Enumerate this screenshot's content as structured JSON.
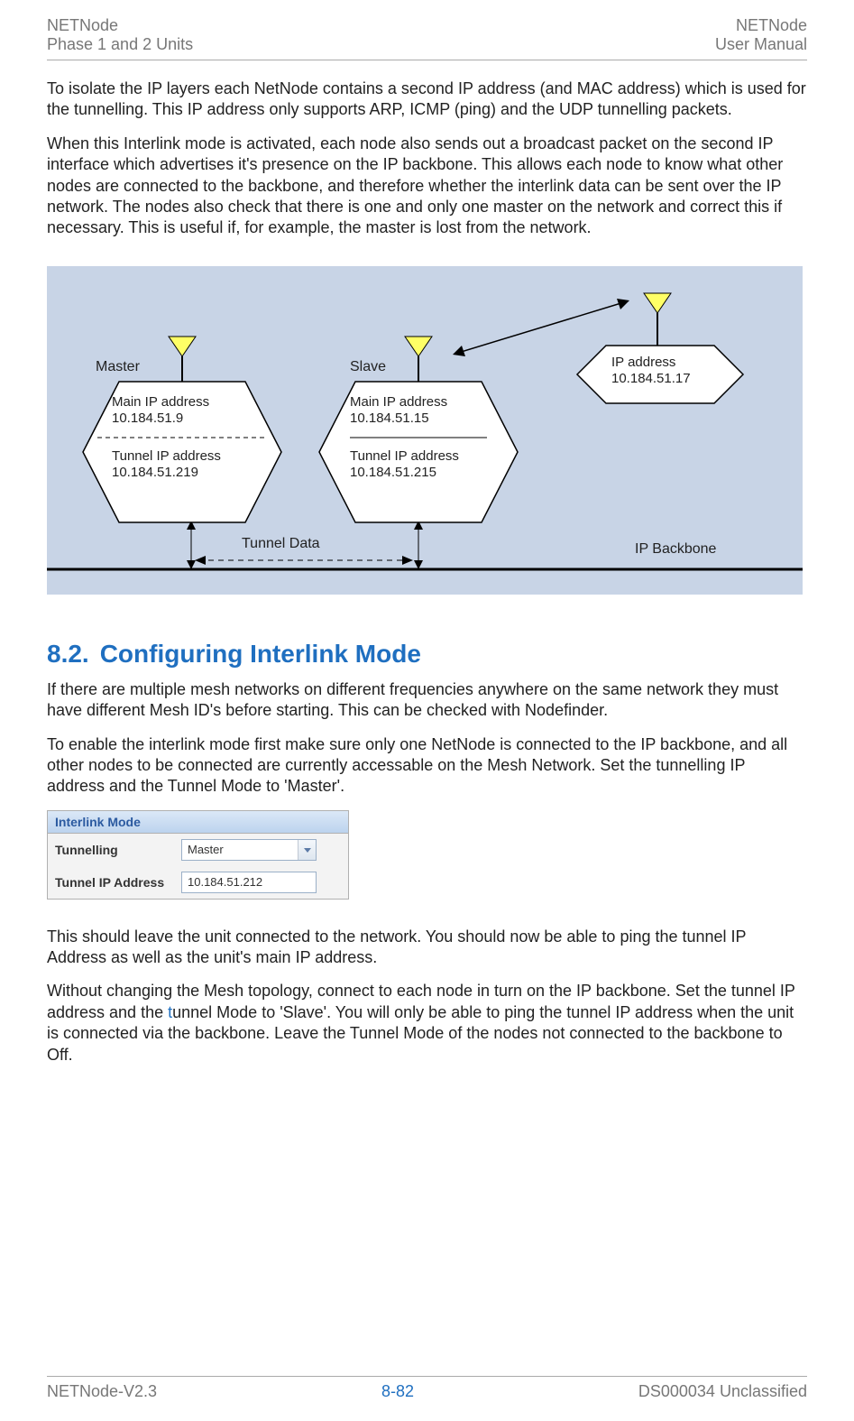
{
  "header": {
    "top_left_line1": "NETNode",
    "top_left_line2": "Phase 1 and 2 Units",
    "top_right_line1": "NETNode",
    "top_right_line2": "User Manual"
  },
  "paragraphs": {
    "p1": "To isolate the IP layers each NetNode contains a second IP address (and MAC address) which is used for the tunnelling. This IP address only supports ARP, ICMP (ping) and the UDP tunnelling packets.",
    "p2": "When this Interlink mode is activated, each node also sends out a broadcast packet on the second IP interface which advertises it's presence on the IP backbone. This allows each node to know what other nodes are connected to the backbone, and therefore whether the interlink data can be sent over the IP network. The nodes also check that there is one and only one master on the network and correct this if necessary. This is useful if, for example, the master is lost from the network.",
    "p3": "If there are multiple mesh networks on different frequencies anywhere on the same network they must have different Mesh ID's before starting. This can be checked with Nodefinder.",
    "p4": "To enable the interlink mode first make sure only one NetNode is connected to the IP backbone, and all other nodes to be connected are currently accessable on the Mesh Network. Set the tunnelling IP address and the Tunnel Mode to 'Master'.",
    "p5": "This should leave the unit connected to the network. You should now be able to ping the tunnel IP Address as well as the unit's main IP address.",
    "p6_a": "Without changing the Mesh topology, connect to each node in turn on the IP backbone. Set the tunnel IP address and the ",
    "p6_t": "t",
    "p6_b": "unnel Mode to 'Slave'. You will only be able to ping the tunnel IP address when the unit is connected via the backbone. Leave the Tunnel Mode of the nodes not connected to the backbone to Off."
  },
  "section": {
    "number": "8.2.",
    "title": "Configuring Interlink Mode"
  },
  "diagram": {
    "master_label": "Master",
    "slave_label": "Slave",
    "master_main_ip_label": "Main IP address",
    "master_main_ip_value": "10.184.51.9",
    "master_tunnel_ip_label": "Tunnel IP address",
    "master_tunnel_ip_value": "10.184.51.219",
    "slave_main_ip_label": "Main IP address",
    "slave_main_ip_value": "10.184.51.15",
    "slave_tunnel_ip_label": "Tunnel IP address",
    "slave_tunnel_ip_value": "10.184.51.215",
    "right_ip_label": "IP address",
    "right_ip_value": "10.184.51.17",
    "tunnel_data": "Tunnel Data",
    "backbone": "IP Backbone"
  },
  "interlink": {
    "panel_title": "Interlink Mode",
    "tunnelling_label": "Tunnelling",
    "tunnelling_value": "Master",
    "tunnel_ip_label": "Tunnel IP Address",
    "tunnel_ip_value": "10.184.51.212"
  },
  "footer": {
    "left": "NETNode-V2.3",
    "mid": "8-82",
    "right": "DS000034 Unclassified"
  }
}
